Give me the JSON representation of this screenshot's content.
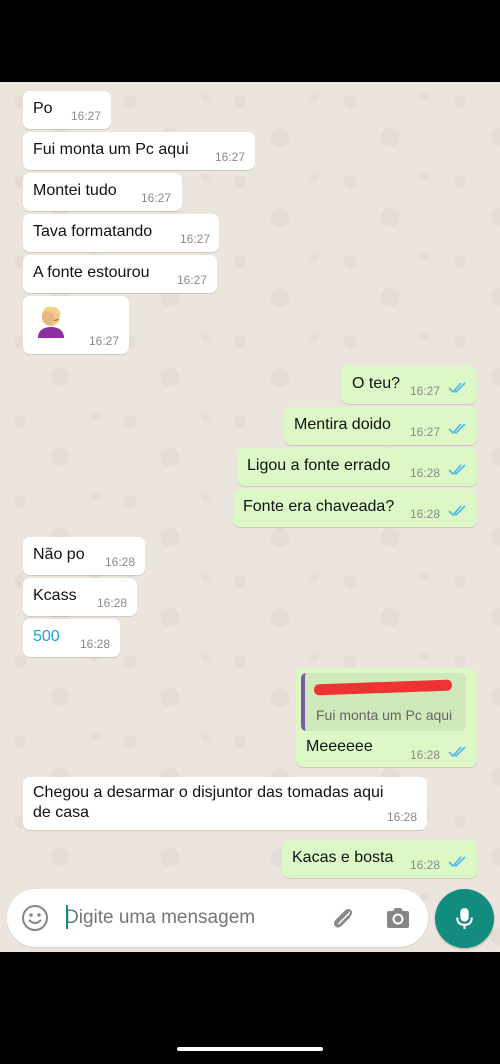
{
  "messages": [
    {
      "text": "Po",
      "time": "16:27"
    },
    {
      "text": "Fui monta um Pc aqui",
      "time": "16:27"
    },
    {
      "text": "Montei tudo",
      "time": "16:27"
    },
    {
      "text": "Tava formatando",
      "time": "16:27"
    },
    {
      "text": "A fonte estourou",
      "time": "16:27"
    },
    {
      "emoji": "face-palm-emoji",
      "time": "16:27"
    },
    {
      "text": "O teu?",
      "time": "16:27"
    },
    {
      "text": "Mentira doido",
      "time": "16:27"
    },
    {
      "text": "Ligou a fonte errado",
      "time": "16:28"
    },
    {
      "text": "Fonte era chaveada?",
      "time": "16:28"
    },
    {
      "text": "Não po",
      "time": "16:28"
    },
    {
      "text": "Kcass",
      "time": "16:28"
    },
    {
      "text": "500",
      "time": "16:28"
    },
    {
      "text": "Meeeeee",
      "time": "16:28",
      "reply_quote": "Fui monta um Pc aqui"
    },
    {
      "line1": "Chegou a desarmar o disjuntor das tomadas aqui",
      "line2": "de casa",
      "time": "16:28"
    },
    {
      "text": "Kacas e bosta",
      "time": "16:28"
    }
  ],
  "input": {
    "placeholder": "Digite uma mensagem"
  },
  "colors": {
    "incoming_bubble": "#ffffff",
    "outgoing_bubble": "#dcf8c6",
    "read_ticks": "#4fb6ec",
    "accent": "#128c7e",
    "chat_background": "#ece5dd"
  },
  "icons": [
    "emoji-icon",
    "attach-icon",
    "camera-icon",
    "mic-icon",
    "double-check-icon"
  ]
}
